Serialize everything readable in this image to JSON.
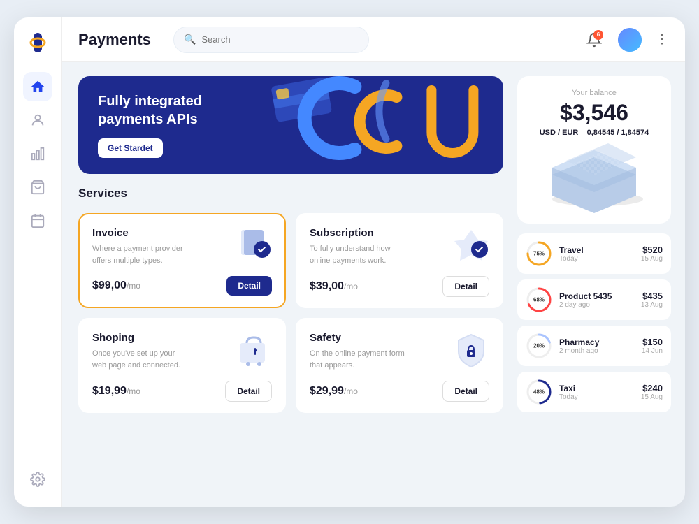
{
  "app": {
    "title": "Payments"
  },
  "header": {
    "search_placeholder": "Search",
    "bell_count": "6",
    "more_icon": "⋮"
  },
  "sidebar": {
    "nav_items": [
      {
        "id": "home",
        "label": "Home",
        "active": true
      },
      {
        "id": "user",
        "label": "User",
        "active": false
      },
      {
        "id": "analytics",
        "label": "Analytics",
        "active": false
      },
      {
        "id": "bag",
        "label": "Shopping",
        "active": false
      },
      {
        "id": "calendar",
        "label": "Calendar",
        "active": false
      }
    ],
    "settings_label": "Settings"
  },
  "banner": {
    "title": "Fully integrated\npayments APIs",
    "button_label": "Get Stardet"
  },
  "services": {
    "section_title": "Services",
    "items": [
      {
        "id": "invoice",
        "name": "Invoice",
        "description": "Where a payment provider offers multiple types.",
        "price": "$99,00",
        "per": "/mo",
        "button": "Detail",
        "active": true
      },
      {
        "id": "subscription",
        "name": "Subscription",
        "description": "To fully understand how online payments work.",
        "price": "$39,00",
        "per": "/mo",
        "button": "Detail",
        "active": false
      },
      {
        "id": "shoping",
        "name": "Shoping",
        "description": "Once you've set up your web page and connected.",
        "price": "$19,99",
        "per": "/mo",
        "button": "Detail",
        "active": false
      },
      {
        "id": "safety",
        "name": "Safety",
        "description": "On the online payment form that appears.",
        "price": "$29,99",
        "per": "/mo",
        "button": "Detail",
        "active": false
      }
    ]
  },
  "balance": {
    "label": "Your balance",
    "amount": "$3,546",
    "currency_label": "USD / EUR",
    "rate": "0,84545 / 1,84574"
  },
  "transactions": [
    {
      "id": "travel",
      "name": "Travel",
      "date": "Today",
      "amount": "$520",
      "day": "15 Aug",
      "percent": 75,
      "color": "#f5a623"
    },
    {
      "id": "product",
      "name": "Product 5435",
      "date": "2 day ago",
      "amount": "$435",
      "day": "13 Aug",
      "percent": 68,
      "color": "#ff4444"
    },
    {
      "id": "pharmacy",
      "name": "Pharmacy",
      "date": "2 month ago",
      "amount": "$150",
      "day": "14 Jun",
      "percent": 20,
      "color": "#aac4ff"
    },
    {
      "id": "taxi",
      "name": "Taxi",
      "date": "Today",
      "amount": "$240",
      "day": "15 Aug",
      "percent": 48,
      "color": "#1e2a8e"
    }
  ]
}
